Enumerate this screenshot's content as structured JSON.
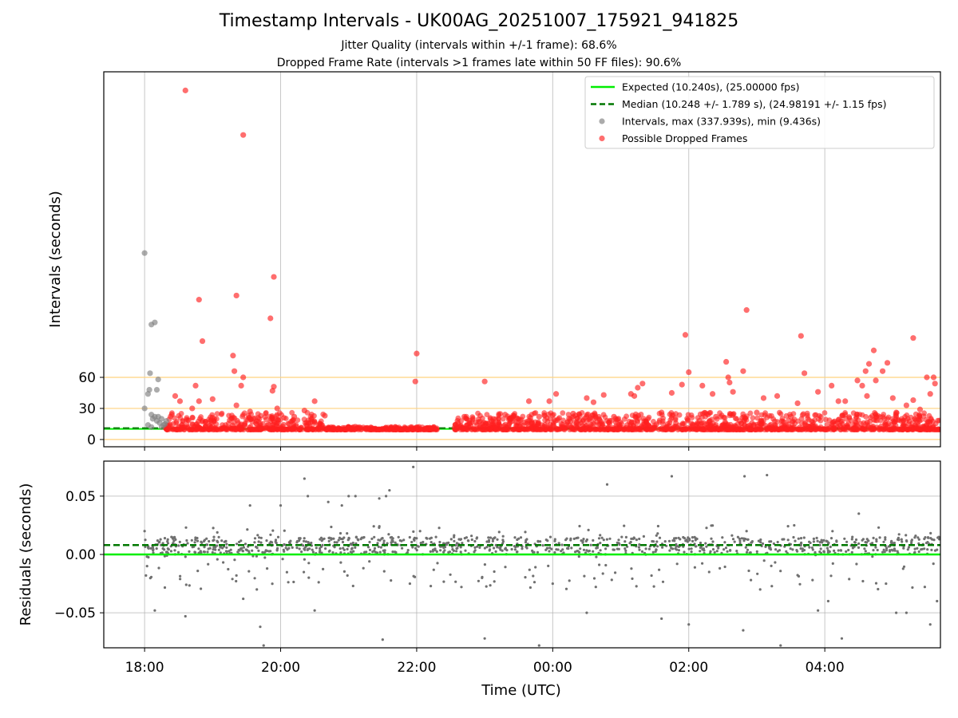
{
  "chart_data": [
    {
      "type": "scatter",
      "title": "Timestamp Intervals - UK00AG_20251007_175921_941825",
      "subtitles": [
        "Jitter Quality (intervals within +/-1 frame): 68.6%",
        "Dropped Frame Rate (intervals >1 frames late within 50 FF files): 90.6%"
      ],
      "xlabel": "",
      "ylabel": "Intervals (seconds)",
      "xlim_hours": [
        17.4,
        29.7
      ],
      "ylim": [
        -7,
        355
      ],
      "yticks": [
        0,
        30,
        60
      ],
      "ytick_labels": [
        "0",
        "30",
        "60"
      ],
      "reference_lines": [
        0,
        30,
        60
      ],
      "reference_color": "#ffd27f",
      "grid_x": true,
      "legend": {
        "placement": "upper right",
        "entries": [
          {
            "label": "Expected (10.240s), (25.00000 fps)",
            "style": "solid-line",
            "color": "#00ee00"
          },
          {
            "label": "Median (10.248 +/- 1.789 s), (24.98191 +/- 1.15 fps)",
            "style": "dashed-line",
            "color": "#007700"
          },
          {
            "label": "Intervals, max (337.939s), min (9.436s)",
            "style": "marker",
            "color": "#888888"
          },
          {
            "label": "Possible Dropped Frames",
            "style": "marker",
            "color": "#ff3030"
          }
        ]
      },
      "expected_value": 10.24,
      "median_value": 10.248,
      "series": [
        {
          "name": "Intervals, max (337.939s), min (9.436s)",
          "color": "#808080",
          "points": [
            [
              18.0,
              30
            ],
            [
              18.0,
              180
            ],
            [
              18.05,
              44
            ],
            [
              18.07,
              48
            ],
            [
              18.08,
              64
            ],
            [
              18.1,
              111
            ],
            [
              18.15,
              113
            ],
            [
              18.18,
              48
            ],
            [
              18.2,
              58
            ],
            [
              18.1,
              24
            ],
            [
              18.12,
              20
            ],
            [
              18.15,
              22
            ],
            [
              18.18,
              18
            ],
            [
              18.22,
              16
            ],
            [
              18.25,
              20
            ],
            [
              18.28,
              14
            ],
            [
              18.05,
              14
            ],
            [
              18.1,
              12
            ],
            [
              18.2,
              22
            ],
            [
              18.25,
              12
            ],
            [
              18.3,
              15
            ],
            [
              18.32,
              18
            ]
          ]
        },
        {
          "name": "Possible Dropped Frames",
          "color": "#ff2020",
          "points": [
            [
              18.6,
              337
            ],
            [
              19.45,
              294
            ],
            [
              19.9,
              157
            ],
            [
              18.8,
              135
            ],
            [
              19.35,
              139
            ],
            [
              19.85,
              117
            ],
            [
              18.85,
              95
            ],
            [
              19.3,
              81
            ],
            [
              19.32,
              66
            ],
            [
              19.45,
              60
            ],
            [
              18.75,
              52
            ],
            [
              19.42,
              52
            ],
            [
              19.88,
              47
            ],
            [
              19.9,
              51
            ],
            [
              18.45,
              42
            ],
            [
              18.52,
              37
            ],
            [
              18.8,
              37
            ],
            [
              19.0,
              39
            ],
            [
              19.35,
              33
            ],
            [
              19.55,
              27
            ],
            [
              19.95,
              30
            ],
            [
              18.4,
              24
            ],
            [
              18.7,
              30
            ],
            [
              19.6,
              20
            ],
            [
              20.35,
              28
            ],
            [
              20.5,
              37
            ],
            [
              20.65,
              23
            ],
            [
              22.0,
              83
            ],
            [
              21.98,
              56
            ],
            [
              23.0,
              56
            ],
            [
              23.65,
              37
            ],
            [
              23.95,
              37
            ],
            [
              24.05,
              44
            ],
            [
              24.5,
              40
            ],
            [
              24.6,
              36
            ],
            [
              24.75,
              43
            ],
            [
              25.15,
              44
            ],
            [
              25.2,
              42
            ],
            [
              25.25,
              50
            ],
            [
              25.32,
              54
            ],
            [
              25.75,
              45
            ],
            [
              25.9,
              53
            ],
            [
              25.95,
              101
            ],
            [
              26.0,
              65
            ],
            [
              26.2,
              52
            ],
            [
              26.35,
              44
            ],
            [
              26.55,
              75
            ],
            [
              26.58,
              60
            ],
            [
              26.6,
              55
            ],
            [
              26.65,
              46
            ],
            [
              26.8,
              66
            ],
            [
              26.85,
              125
            ],
            [
              27.1,
              40
            ],
            [
              27.3,
              42
            ],
            [
              27.65,
              100
            ],
            [
              27.7,
              64
            ],
            [
              27.6,
              35
            ],
            [
              27.9,
              46
            ],
            [
              28.1,
              52
            ],
            [
              28.2,
              37
            ],
            [
              28.3,
              37
            ],
            [
              28.48,
              57
            ],
            [
              28.55,
              52
            ],
            [
              28.6,
              66
            ],
            [
              28.65,
              73
            ],
            [
              28.72,
              86
            ],
            [
              28.62,
              42
            ],
            [
              28.75,
              57
            ],
            [
              28.85,
              66
            ],
            [
              28.92,
              74
            ],
            [
              29.0,
              40
            ],
            [
              29.3,
              98
            ],
            [
              29.3,
              38
            ],
            [
              29.5,
              60
            ],
            [
              29.6,
              60
            ],
            [
              29.62,
              54
            ],
            [
              29.55,
              44
            ],
            [
              29.2,
              33
            ],
            [
              29.4,
              29
            ],
            [
              29.05,
              26
            ],
            [
              28.3,
              24
            ],
            [
              27.5,
              22
            ],
            [
              27.0,
              26
            ],
            [
              26.4,
              22
            ],
            [
              25.6,
              26
            ],
            [
              24.9,
              22
            ],
            [
              24.3,
              25
            ],
            [
              23.8,
              22
            ],
            [
              23.3,
              24
            ],
            [
              22.7,
              22
            ],
            [
              22.6,
              18
            ],
            [
              21.0,
              12
            ],
            [
              20.2,
              22
            ]
          ]
        }
      ],
      "dense_band": {
        "series": "Possible Dropped Frames",
        "segments": [
          {
            "x_range": [
              18.3,
              20.65
            ],
            "y_range": [
              9.5,
              26
            ]
          },
          {
            "x_range": [
              20.65,
              22.3
            ],
            "y_range": [
              9.5,
              12.5
            ]
          },
          {
            "x_range": [
              22.55,
              29.7
            ],
            "y_range": [
              9.5,
              26
            ]
          }
        ]
      }
    },
    {
      "type": "scatter",
      "title": "",
      "xlabel": "Time (UTC)",
      "ylabel": "Residuals (seconds)",
      "xlim_hours": [
        17.4,
        29.7
      ],
      "ylim": [
        -0.08,
        0.08
      ],
      "yticks": [
        -0.05,
        0.0,
        0.05
      ],
      "ytick_labels": [
        "−0.05",
        "0.00",
        "0.05"
      ],
      "xticks_hours": [
        18,
        20,
        22,
        24,
        26,
        28
      ],
      "xtick_labels": [
        "18:00",
        "20:00",
        "22:00",
        "00:00",
        "02:00",
        "04:00"
      ],
      "grid": true,
      "expected_residual": 0.0,
      "median_residual": 0.008,
      "series": [
        {
          "name": "Residuals",
          "color": "#707070",
          "points": [
            [
              18.0,
              0.02
            ],
            [
              18.02,
              -0.018
            ],
            [
              18.15,
              -0.048
            ],
            [
              18.6,
              -0.053
            ],
            [
              19.55,
              0.042
            ],
            [
              19.35,
              -0.018
            ],
            [
              19.45,
              -0.038
            ],
            [
              19.75,
              -0.078
            ],
            [
              19.7,
              -0.062
            ],
            [
              19.65,
              -0.03
            ],
            [
              20.0,
              0.042
            ],
            [
              20.35,
              0.065
            ],
            [
              20.4,
              0.05
            ],
            [
              20.5,
              -0.048
            ],
            [
              20.7,
              0.045
            ],
            [
              20.9,
              0.042
            ],
            [
              21.0,
              0.05
            ],
            [
              21.1,
              0.05
            ],
            [
              21.45,
              0.048
            ],
            [
              21.55,
              0.05
            ],
            [
              21.6,
              0.055
            ],
            [
              21.95,
              0.075
            ],
            [
              21.5,
              -0.073
            ],
            [
              21.9,
              -0.025
            ],
            [
              22.05,
              0.02
            ],
            [
              23.0,
              -0.072
            ],
            [
              23.8,
              -0.078
            ],
            [
              24.0,
              -0.025
            ],
            [
              24.5,
              -0.05
            ],
            [
              24.8,
              0.06
            ],
            [
              25.6,
              -0.055
            ],
            [
              25.75,
              0.067
            ],
            [
              26.0,
              -0.06
            ],
            [
              26.3,
              -0.015
            ],
            [
              26.8,
              -0.065
            ],
            [
              26.82,
              0.067
            ],
            [
              26.85,
              0.02
            ],
            [
              27.05,
              -0.03
            ],
            [
              27.15,
              0.068
            ],
            [
              27.35,
              -0.078
            ],
            [
              27.55,
              0.025
            ],
            [
              27.9,
              -0.048
            ],
            [
              28.05,
              -0.04
            ],
            [
              28.25,
              -0.072
            ],
            [
              28.5,
              0.035
            ],
            [
              28.9,
              -0.025
            ],
            [
              29.05,
              -0.05
            ],
            [
              29.2,
              -0.05
            ],
            [
              29.55,
              -0.06
            ],
            [
              29.65,
              -0.04
            ]
          ]
        }
      ],
      "dense_band": {
        "series": "Residuals",
        "x_range": [
          18.0,
          29.7
        ],
        "y_range": [
          -0.03,
          0.025
        ],
        "core_y_range": [
          0.0,
          0.015
        ]
      }
    }
  ]
}
